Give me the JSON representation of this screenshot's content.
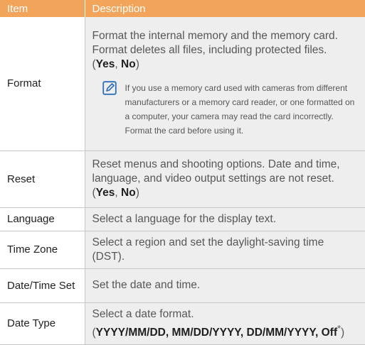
{
  "header": {
    "item": "Item",
    "description": "Description"
  },
  "rows": [
    {
      "item": "Format",
      "line1": "Format the internal memory and the memory card. Format deletes all files, including protected files.",
      "opt_open": "(",
      "opt_yes": "Yes",
      "opt_sep": ", ",
      "opt_no": "No",
      "opt_close": ")",
      "note_icon": "note-pencil-icon",
      "note": "If you use a memory card used with cameras from different manufacturers or a memory card reader, or one formatted on a computer, your camera may read the card incorrectly. Format the card before using it."
    },
    {
      "item": "Reset",
      "line1": "Reset menus and shooting options. Date and time, language, and video output settings are not reset.",
      "opt_open": "(",
      "opt_yes": "Yes",
      "opt_sep": ", ",
      "opt_no": "No",
      "opt_close": ")"
    },
    {
      "item": "Language",
      "desc": "Select a language for the display text."
    },
    {
      "item": "Time Zone",
      "desc": "Select a region and set the daylight-saving time (DST)."
    },
    {
      "item": "Date/Time Set",
      "desc": "Set the date and time."
    },
    {
      "item": "Date Type",
      "line1": "Select a date format.",
      "opt_open": "(",
      "opt_values": "YYYY/MM/DD, MM/DD/YYYY, DD/MM/YYYY, Off",
      "opt_star": "*",
      "opt_close": ")"
    }
  ],
  "colors": {
    "header_bg": "#f2a45a",
    "desc_bg": "#eeeeee",
    "grid": "#c7c7c7",
    "icon": "#2f6fb8"
  }
}
